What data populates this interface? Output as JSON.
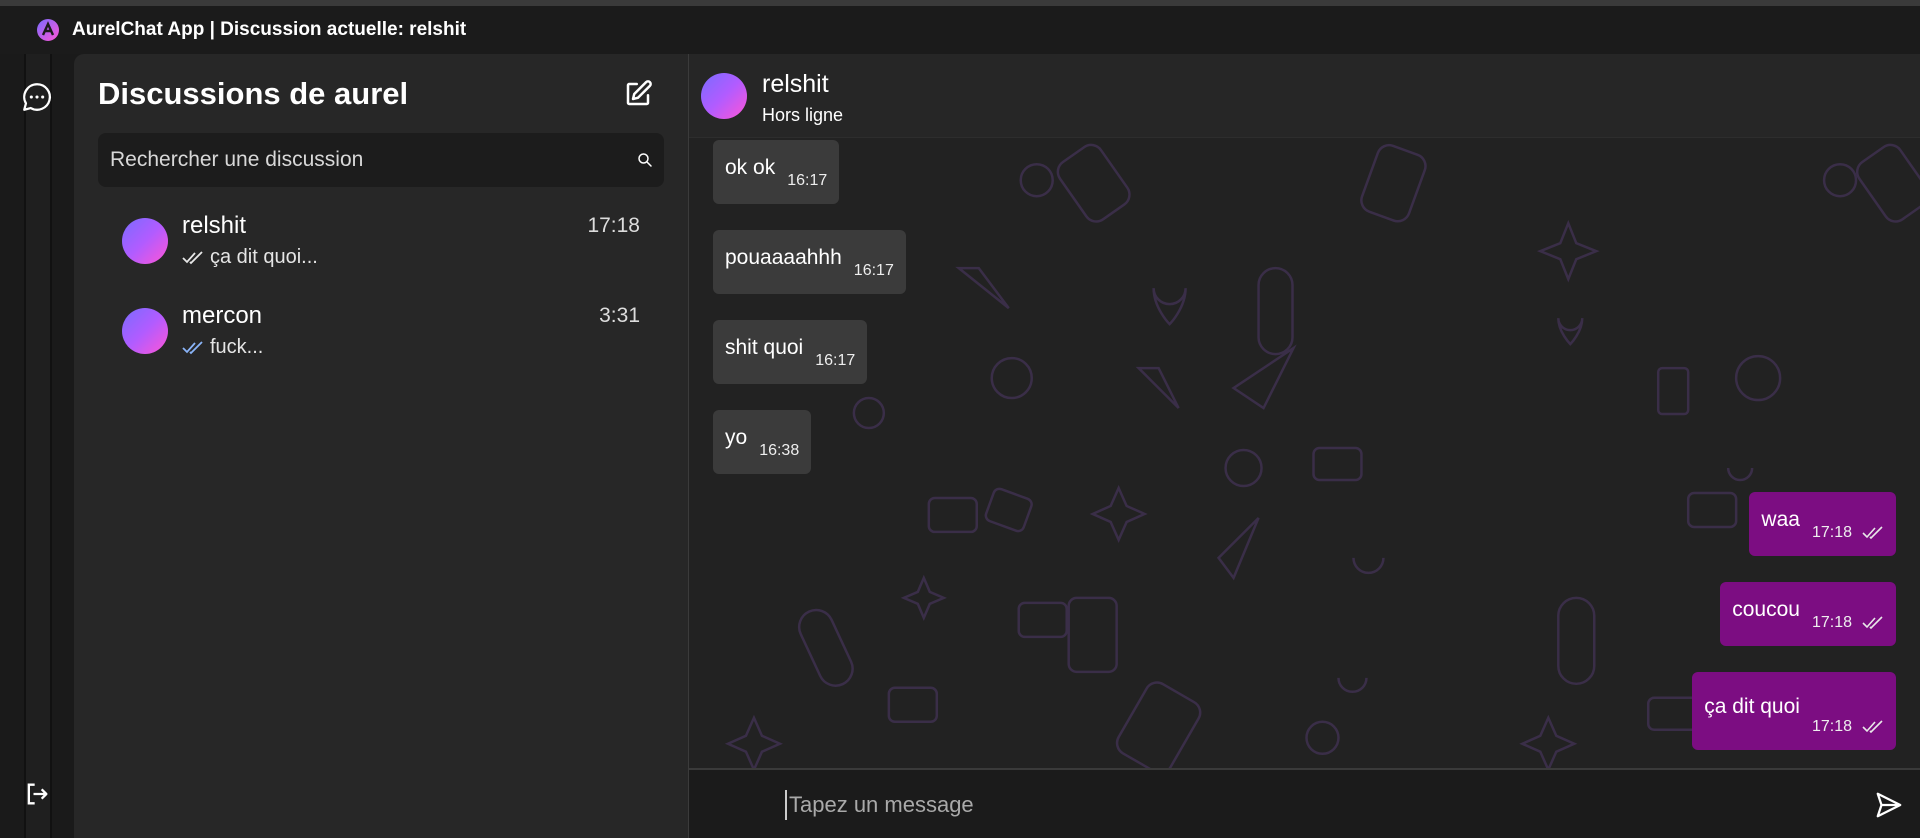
{
  "window": {
    "title": "AurelChat App | Discussion actuelle: relshit"
  },
  "rail": {
    "chat_icon": "chat-bubble-icon",
    "logout_icon": "logout-icon"
  },
  "sidebar": {
    "title": "Discussions de aurel",
    "compose_icon": "edit-icon",
    "search": {
      "placeholder": "Rechercher une discussion",
      "value": ""
    },
    "conversations": [
      {
        "name": "relshit",
        "time": "17:18",
        "preview": "ça dit quoi...",
        "read": true
      },
      {
        "name": "mercon",
        "time": "3:31",
        "preview": "fuck...",
        "read": true
      }
    ]
  },
  "chat": {
    "contact_name": "relshit",
    "contact_status": "Hors ligne",
    "messages": [
      {
        "direction": "in",
        "text": "ok ok",
        "time": "16:17"
      },
      {
        "direction": "in",
        "text": "pouaaaahhh",
        "time": "16:17"
      },
      {
        "direction": "in",
        "text": "shit quoi",
        "time": "16:17"
      },
      {
        "direction": "in",
        "text": "yo",
        "time": "16:38"
      },
      {
        "direction": "out",
        "text": "waa",
        "time": "17:18"
      },
      {
        "direction": "out",
        "text": "coucou",
        "time": "17:18"
      },
      {
        "direction": "out",
        "text": "ça dit quoi",
        "time": "17:18"
      }
    ],
    "composer": {
      "placeholder": "Tapez un message",
      "value": ""
    }
  },
  "colors": {
    "accent": "#7c0d82",
    "incoming_bubble": "#3b3b3b",
    "read_check": "#8ab4f8"
  }
}
